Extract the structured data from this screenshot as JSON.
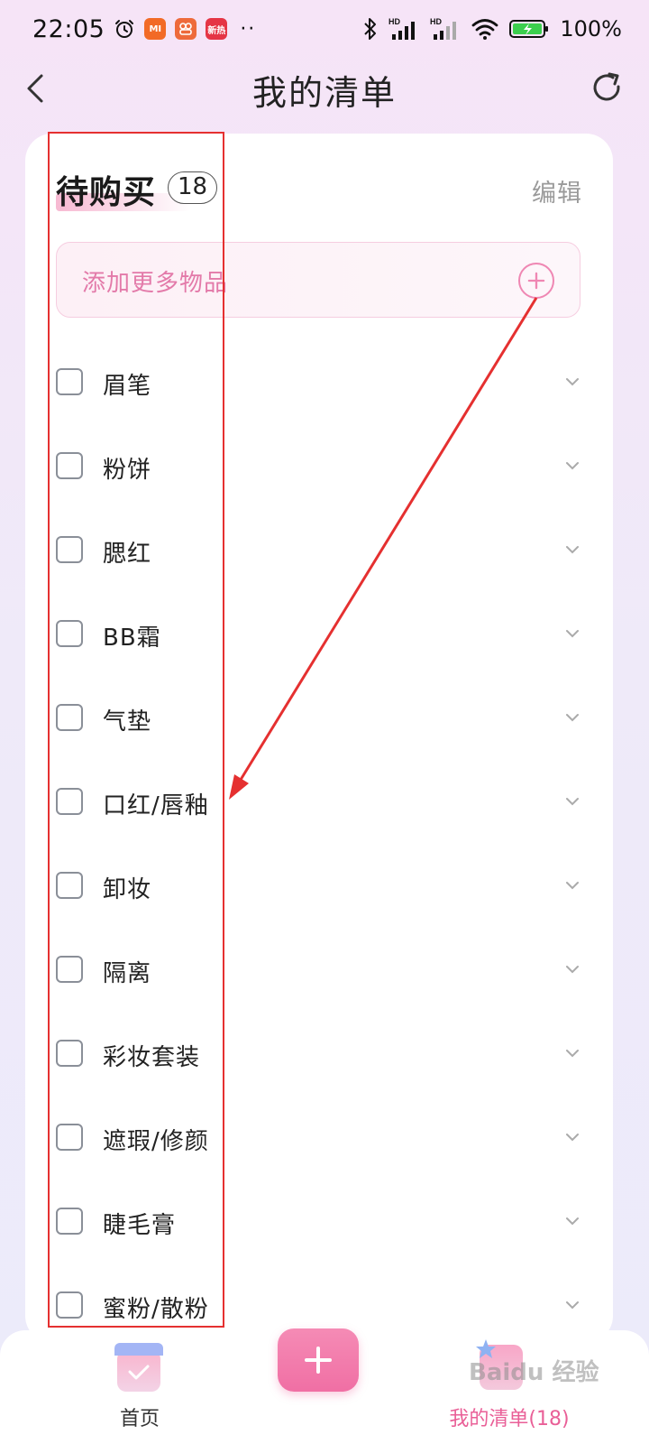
{
  "status_bar": {
    "time": "22:05",
    "app_badges": [
      "MI",
      "",
      "新热"
    ],
    "dots": "··",
    "network_1": "HD",
    "network_2": "HD",
    "battery": "100%"
  },
  "header": {
    "title": "我的清单"
  },
  "section": {
    "title": "待购买",
    "count": "18",
    "edit_label": "编辑"
  },
  "add_item": {
    "label": "添加更多物品"
  },
  "items": [
    {
      "label": "眉笔"
    },
    {
      "label": "粉饼"
    },
    {
      "label": "腮红"
    },
    {
      "label": "BB霜"
    },
    {
      "label": "气垫"
    },
    {
      "label": "口红/唇釉"
    },
    {
      "label": "卸妆"
    },
    {
      "label": "隔离"
    },
    {
      "label": "彩妆套装"
    },
    {
      "label": "遮瑕/修颜"
    },
    {
      "label": "睫毛膏"
    },
    {
      "label": "蜜粉/散粉"
    }
  ],
  "bottom_nav": {
    "home_label": "首页",
    "list_label": "我的清单(18)"
  },
  "watermark": "Baidu 经验",
  "colors": {
    "accent_pink": "#f06fa4",
    "annotation_red": "#e53030",
    "edit_gray": "#9a9a9a"
  }
}
